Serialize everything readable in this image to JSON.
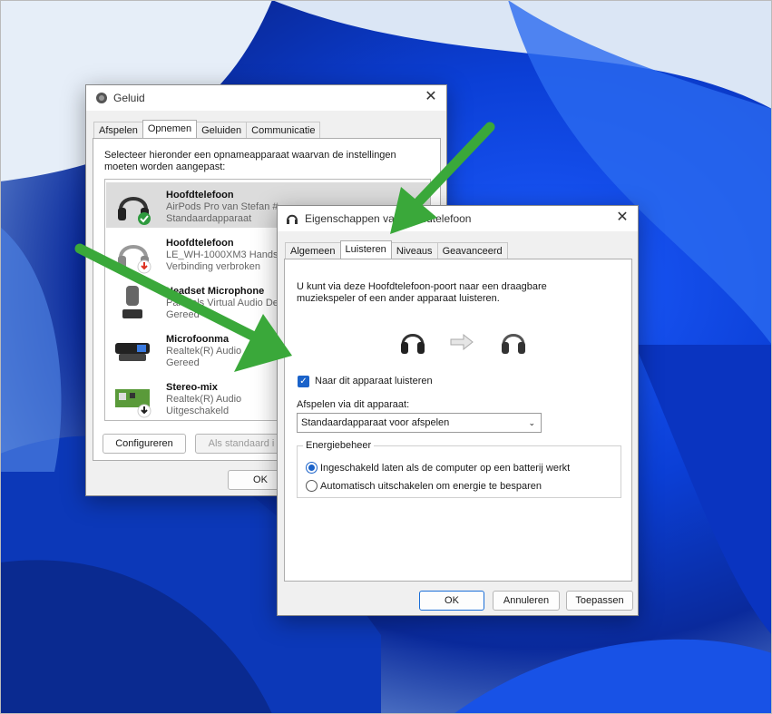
{
  "sound_dialog": {
    "title": "Geluid",
    "tabs": [
      "Afspelen",
      "Opnemen",
      "Geluiden",
      "Communicatie"
    ],
    "active_tab": "Opnemen",
    "instruction": "Selecteer hieronder een opnameapparaat waarvan de instellingen moeten worden aangepast:",
    "devices": [
      {
        "name": "Hoofdtelefoon",
        "line2": "AirPods Pro van Stefan #",
        "line3": "Standaardapparaat",
        "status": "default",
        "selected": true
      },
      {
        "name": "Hoofdtelefoon",
        "line2": "LE_WH-1000XM3 Hands-",
        "line3": "Verbinding verbroken",
        "status": "disconnected"
      },
      {
        "name": "Headset Microphone",
        "line2": "Parallels Virtual Audio De",
        "line3": "Gereed",
        "status": "ready"
      },
      {
        "name": "Microfoonma",
        "line2": "Realtek(R) Audio",
        "line3": "Gereed",
        "status": "ready"
      },
      {
        "name": "Stereo-mix",
        "line2": "Realtek(R) Audio",
        "line3": "Uitgeschakeld",
        "status": "disabled"
      }
    ],
    "configure_button": "Configureren",
    "set_default_button": "Als standaard i",
    "ok_button": "OK"
  },
  "properties_dialog": {
    "title": "Eigenschappen van Hoofdtelefoon",
    "tabs": [
      "Algemeen",
      "Luisteren",
      "Niveaus",
      "Geavanceerd"
    ],
    "active_tab": "Luisteren",
    "description_line1": "U kunt via deze Hoofdtelefoon-poort naar een draagbare",
    "description_line2": "muziekspeler of een ander apparaat luisteren.",
    "listen_checkbox_label": "Naar dit apparaat luisteren",
    "listen_checked": true,
    "playback_label": "Afspelen via dit apparaat:",
    "playback_selected": "Standaardapparaat voor afspelen",
    "power_group_label": "Energiebeheer",
    "power_options": [
      {
        "label": "Ingeschakeld laten als de computer op een batterij werkt",
        "checked": true
      },
      {
        "label": "Automatisch uitschakelen om energie te besparen",
        "checked": false
      }
    ],
    "ok_button": "OK",
    "cancel_button": "Annuleren",
    "apply_button": "Toepassen"
  },
  "colors": {
    "accent": "#1a62c9",
    "annotation_arrow": "#3aa83a"
  }
}
